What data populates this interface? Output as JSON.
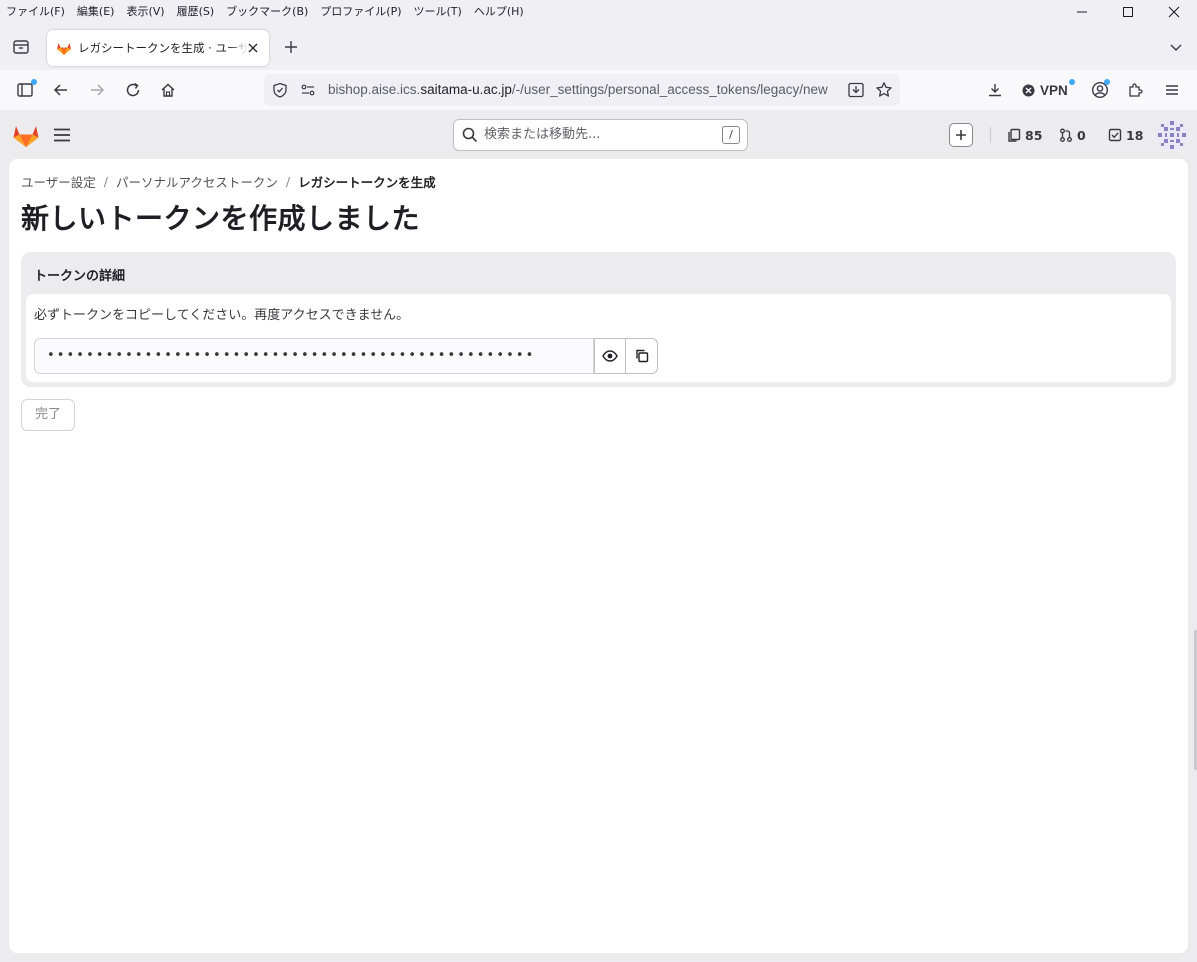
{
  "menubar": {
    "items": [
      "ファイル(F)",
      "編集(E)",
      "表示(V)",
      "履歴(S)",
      "ブックマーク(B)",
      "プロファイル(P)",
      "ツール(T)",
      "ヘルプ(H)"
    ]
  },
  "tab": {
    "title": "レガシートークンを生成 · ユーザー設定 · GitLab"
  },
  "urlbar": {
    "prefix": "bishop.aise.ics.",
    "host": "saitama-u.ac.jp",
    "path": "/-/user_settings/personal_access_tokens/legacy/new"
  },
  "toolbar": {
    "vpn_label": "VPN"
  },
  "gitlab": {
    "search_placeholder": "検索または移動先...",
    "search_shortcut": "/",
    "counters": {
      "issues": "85",
      "merge_requests": "0",
      "todos": "18"
    }
  },
  "breadcrumb": {
    "items": [
      "ユーザー設定",
      "パーソナルアクセストークン",
      "レガシートークンを生成"
    ]
  },
  "page": {
    "title": "新しいトークンを作成しました"
  },
  "token_card": {
    "header": "トークンの詳細",
    "message": "必ずトークンをコピーしてください。再度アクセスできません。",
    "masked_value": "••••••••••••••••••••••••••••••••••••••••••••••••••"
  },
  "done_button": {
    "label": "完了"
  },
  "colors": {
    "gitlab_orange": "#e24329",
    "gitlab_orange_light": "#fca326",
    "firefox_dot": "#3fa9f5"
  }
}
